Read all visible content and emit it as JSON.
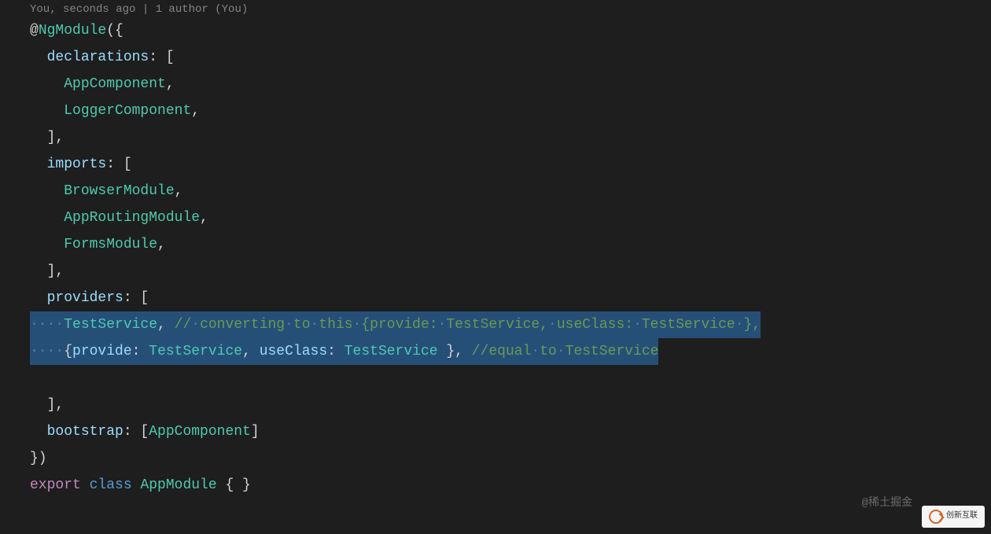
{
  "codelens": "You, seconds ago | 1 author (You)",
  "lines": [
    {
      "segments": [
        {
          "t": "@",
          "c": "tok-decorator"
        },
        {
          "t": "NgModule",
          "c": "tok-class"
        },
        {
          "t": "({",
          "c": "tok-punct"
        }
      ]
    },
    {
      "indent": 1,
      "segments": [
        {
          "t": "declarations",
          "c": "tok-key"
        },
        {
          "t": ": [",
          "c": "tok-colon"
        }
      ]
    },
    {
      "indent": 2,
      "segments": [
        {
          "t": "AppComponent",
          "c": "tok-class"
        },
        {
          "t": ",",
          "c": "tok-punct"
        }
      ]
    },
    {
      "indent": 2,
      "segments": [
        {
          "t": "LoggerComponent",
          "c": "tok-class"
        },
        {
          "t": ",",
          "c": "tok-punct"
        }
      ]
    },
    {
      "indent": 1,
      "segments": [
        {
          "t": "],",
          "c": "tok-punct"
        }
      ]
    },
    {
      "indent": 1,
      "segments": [
        {
          "t": "imports",
          "c": "tok-key"
        },
        {
          "t": ": [",
          "c": "tok-colon"
        }
      ]
    },
    {
      "indent": 2,
      "segments": [
        {
          "t": "BrowserModule",
          "c": "tok-class"
        },
        {
          "t": ",",
          "c": "tok-punct"
        }
      ]
    },
    {
      "indent": 2,
      "segments": [
        {
          "t": "AppRoutingModule",
          "c": "tok-class"
        },
        {
          "t": ",",
          "c": "tok-punct"
        }
      ]
    },
    {
      "indent": 2,
      "segments": [
        {
          "t": "FormsModule",
          "c": "tok-class"
        },
        {
          "t": ",",
          "c": "tok-punct"
        }
      ]
    },
    {
      "indent": 1,
      "segments": [
        {
          "t": "],",
          "c": "tok-punct"
        }
      ]
    },
    {
      "indent": 1,
      "segments": [
        {
          "t": "providers",
          "c": "tok-key"
        },
        {
          "t": ": [",
          "c": "tok-colon"
        }
      ]
    },
    {
      "selected": true,
      "wsIndent": 2,
      "segments": [
        {
          "t": "TestService",
          "c": "tok-class"
        },
        {
          "t": ", ",
          "c": "tok-punct"
        },
        {
          "t": "// converting to this {provide: TestService, useClass: TestService },",
          "c": "tok-comment",
          "ws": true
        }
      ]
    },
    {
      "selected": true,
      "selEnd": true,
      "wsIndent": 2,
      "segments": [
        {
          "t": "{",
          "c": "tok-punct"
        },
        {
          "t": "provide",
          "c": "tok-key"
        },
        {
          "t": ": ",
          "c": "tok-colon"
        },
        {
          "t": "TestService",
          "c": "tok-class"
        },
        {
          "t": ", ",
          "c": "tok-punct"
        },
        {
          "t": "useClass",
          "c": "tok-key"
        },
        {
          "t": ": ",
          "c": "tok-colon"
        },
        {
          "t": "TestService",
          "c": "tok-class"
        },
        {
          "t": " }, ",
          "c": "tok-punct"
        },
        {
          "t": "//equal to TestService",
          "c": "tok-comment",
          "ws": true
        }
      ]
    },
    {
      "indent": 0,
      "segments": []
    },
    {
      "indent": 1,
      "segments": [
        {
          "t": "],",
          "c": "tok-punct"
        }
      ]
    },
    {
      "indent": 1,
      "segments": [
        {
          "t": "bootstrap",
          "c": "tok-key"
        },
        {
          "t": ": [",
          "c": "tok-colon"
        },
        {
          "t": "AppComponent",
          "c": "tok-class"
        },
        {
          "t": "]",
          "c": "tok-punct"
        }
      ]
    },
    {
      "segments": [
        {
          "t": "})",
          "c": "tok-punct"
        }
      ]
    },
    {
      "segments": [
        {
          "t": "export ",
          "c": "tok-keyword"
        },
        {
          "t": "class ",
          "c": "tok-keyword-blue"
        },
        {
          "t": "AppModule",
          "c": "tok-class"
        },
        {
          "t": " { }",
          "c": "tok-punct"
        }
      ]
    }
  ],
  "watermark_right": "@稀土掘金",
  "watermark_logo": "创新互联",
  "indent_size": "  "
}
